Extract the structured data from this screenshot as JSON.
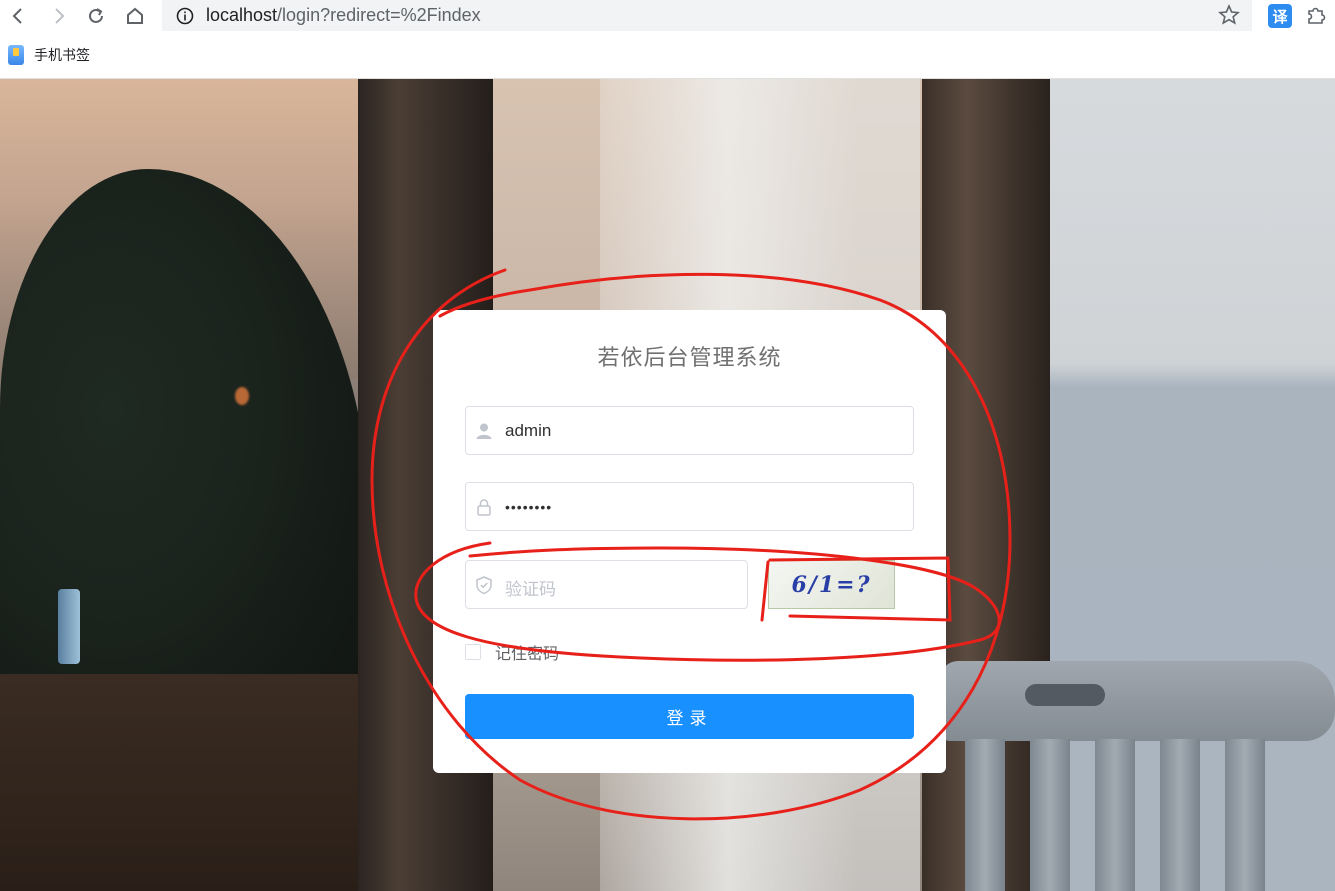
{
  "browser": {
    "url_host": "localhost",
    "url_path": "/login?redirect=%2Findex",
    "translate_label": "译"
  },
  "bookmarks": [
    {
      "label": "手机书签"
    }
  ],
  "login": {
    "title": "若依后台管理系统",
    "username_value": "admin",
    "password_value": "••••••••",
    "code_placeholder": "验证码",
    "captcha_text": "6/1=?",
    "remember_label": "记住密码",
    "submit_label": "登录"
  },
  "colors": {
    "primary": "#1890ff",
    "annotation": "#e8201a"
  }
}
